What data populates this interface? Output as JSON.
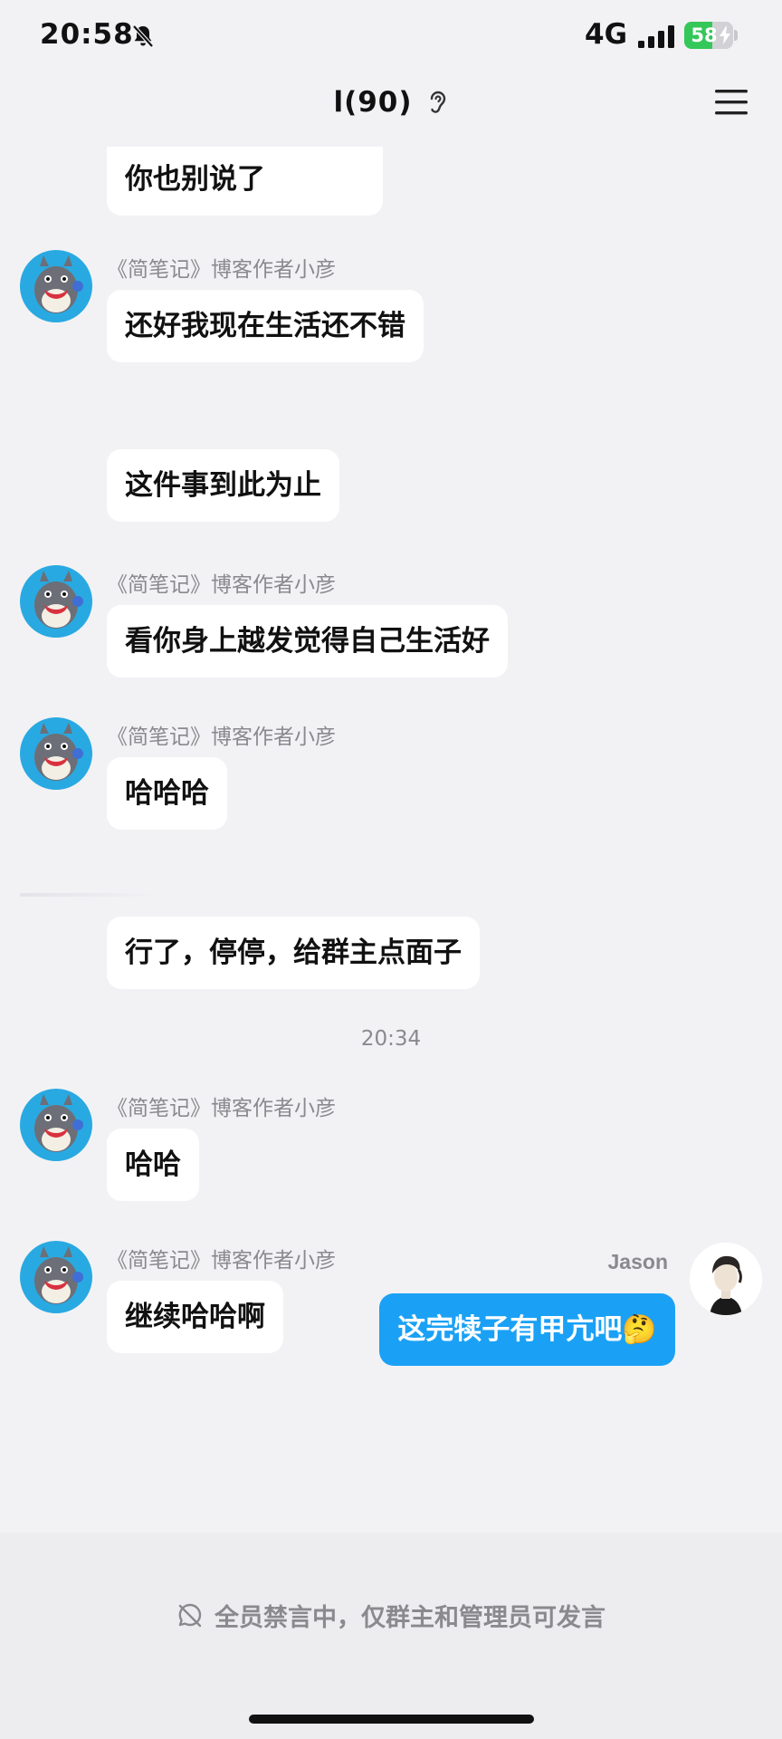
{
  "status_bar": {
    "time": "20:58",
    "network": "4G",
    "battery_level": "58",
    "battery_fraction": 0.58,
    "icons": [
      "bell-off-icon",
      "signal-icon",
      "battery-icon",
      "charging-bolt-icon"
    ]
  },
  "nav": {
    "title": "l(90)",
    "icons": [
      "ear-icon",
      "menu-icon"
    ]
  },
  "messages": [
    {
      "sender": "",
      "text": "你也别说了"
    },
    {
      "sender": "《简笔记》博客作者小彦",
      "text": "还好我现在生活还不错"
    },
    {
      "sender": "",
      "text": "这件事到此为止"
    },
    {
      "sender": "《简笔记》博客作者小彦",
      "text": "看你身上越发觉得自己生活好"
    },
    {
      "sender": "《简笔记》博客作者小彦",
      "text": "哈哈哈"
    },
    {
      "sender": "",
      "text": "行了，停停，给群主点面子"
    },
    {
      "sender": "《简笔记》博客作者小彦",
      "text": "哈哈"
    },
    {
      "sender": "《简笔记》博客作者小彦",
      "text": "继续哈哈啊"
    }
  ],
  "time_divider": "20:34",
  "my_message": {
    "sender": "Jason",
    "text": "这完犊子有甲亢吧🤔"
  },
  "bottom": {
    "mute_notice": "全员禁言中，仅群主和管理员可发言"
  },
  "colors": {
    "background": "#f2f2f5",
    "bubble_incoming": "#ffffff",
    "bubble_outgoing": "#1aa1f5",
    "avatar_ring": "#29a9e1",
    "battery_green": "#34c759"
  }
}
